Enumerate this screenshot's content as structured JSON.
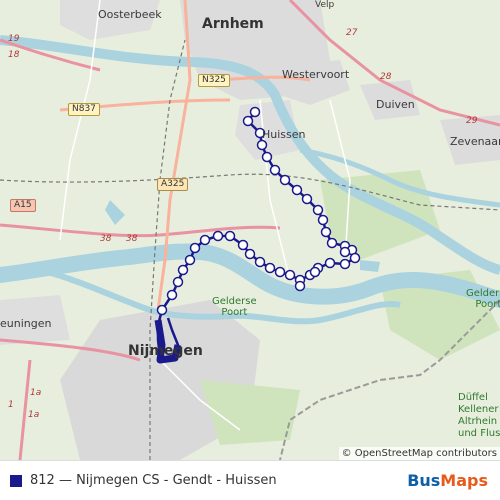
{
  "map": {
    "place_labels": {
      "arnhem": "Arnhem",
      "oosterbeek": "Oosterbeek",
      "westervoort": "Westervoort",
      "duiven": "Duiven",
      "zevenaar": "Zevenaar",
      "huissen": "Huissen",
      "nijmegen": "Nijmegen",
      "beuningen": "euningen",
      "velp": "Velp"
    },
    "park_labels": {
      "gelderse_poort_1": "Gelderse",
      "gelderse_poort_2": "Poort",
      "gelderse_right_1": "Gelderse",
      "gelderse_right_2": "Poort",
      "duffel_1": "Düffel",
      "duffel_2": "Kellener",
      "duffel_3": "Altrhein",
      "duffel_4": "und Flussmar"
    },
    "road_shields": {
      "n325_top": "N325",
      "n837": "N837",
      "a325": "A325",
      "a15": "A15"
    },
    "highway_numbers": {
      "h19": "19",
      "h18": "18",
      "h27": "27",
      "h28": "28",
      "h29": "29",
      "h38a": "38",
      "h38b": "38",
      "h1a": "1a",
      "h1b": "1",
      "h1c": "1a"
    },
    "colors": {
      "background": "#e8eedd",
      "water": "#aad3df",
      "motorway": "#e892a2",
      "trunk": "#f9b29c",
      "route": "#1a1a8c",
      "border": "#9a9a9a"
    }
  },
  "attribution": "© OpenStreetMap contributors",
  "footer": {
    "route_label": "812 — Nijmegen CS - Gendt - Huissen",
    "route_color": "#1a1a8c",
    "brand_part1": "Bus",
    "brand_part2": "Maps"
  }
}
